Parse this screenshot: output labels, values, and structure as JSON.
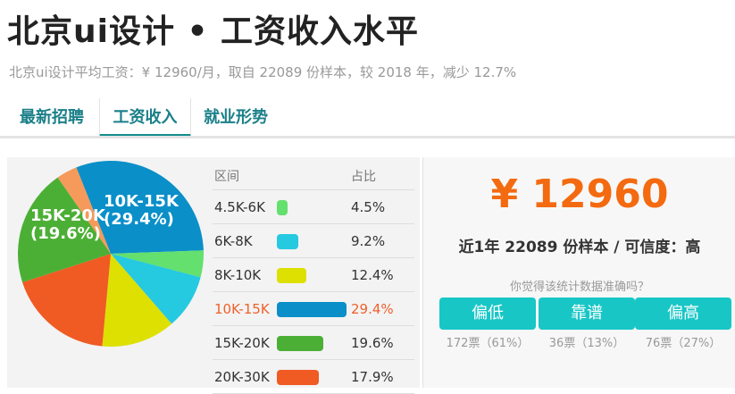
{
  "header": {
    "title": "北京ui设计 • 工资收入水平",
    "subtitle": "北京ui设计平均工资：¥ 12960/月，取自 22089 份样本，较 2018 年，减少 12.7%"
  },
  "tabs": [
    {
      "label": "最新招聘"
    },
    {
      "label": "工资收入"
    },
    {
      "label": "就业形势"
    }
  ],
  "colors": {
    "teal_accent": "#138e8e",
    "tab_text": "#1a7f88",
    "salary_orange": "#f36a10",
    "button_teal": "#18c6c6",
    "highlight_row": "#f0602a"
  },
  "chart_data": {
    "type": "pie",
    "slices": [
      {
        "label": "10K-15K",
        "value": 29.4,
        "color": "#0a8fc8"
      },
      {
        "label": "4.5K-6K",
        "value": 4.5,
        "color": "#63e06e"
      },
      {
        "label": "6K-8K",
        "value": 9.2,
        "color": "#25c9e0"
      },
      {
        "label": "8K-10K",
        "value": 12.4,
        "color": "#dde000"
      },
      {
        "label": "20K-30K",
        "value": 17.9,
        "color": "#f05a23"
      },
      {
        "label": "15K-20K",
        "value": 19.6,
        "color": "#4caf35"
      },
      {
        "label": "",
        "value": 3.5,
        "color": "#f59a5a"
      }
    ],
    "labels_on_pie": [
      {
        "line1": "10K-15K",
        "line2": "(29.4%)"
      },
      {
        "line1": "15K-20K",
        "line2": "(19.6%)"
      }
    ]
  },
  "table": {
    "headers": {
      "range": "区间",
      "share": "占比"
    },
    "rows": [
      {
        "range": "4.5K-6K",
        "pct": "4.5%",
        "value": 4.5,
        "color": "#63e06e",
        "highlight": false
      },
      {
        "range": "6K-8K",
        "pct": "9.2%",
        "value": 9.2,
        "color": "#25c9e0",
        "highlight": false
      },
      {
        "range": "8K-10K",
        "pct": "12.4%",
        "value": 12.4,
        "color": "#dde000",
        "highlight": false
      },
      {
        "range": "10K-15K",
        "pct": "29.4%",
        "value": 29.4,
        "color": "#0a8fc8",
        "highlight": true
      },
      {
        "range": "15K-20K",
        "pct": "19.6%",
        "value": 19.6,
        "color": "#4caf35",
        "highlight": false
      },
      {
        "range": "20K-30K",
        "pct": "17.9%",
        "value": 17.9,
        "color": "#f05a23",
        "highlight": false
      }
    ]
  },
  "summary": {
    "salary": "¥ 12960",
    "confidence": "近1年 22089 份样本 / 可信度：高",
    "ask": "你觉得该统计数据准确吗？"
  },
  "votes": [
    {
      "label": "偏低",
      "count": "172票（61%）"
    },
    {
      "label": "靠谱",
      "count": "36票（13%）"
    },
    {
      "label": "偏高",
      "count": "76票（27%）"
    }
  ]
}
